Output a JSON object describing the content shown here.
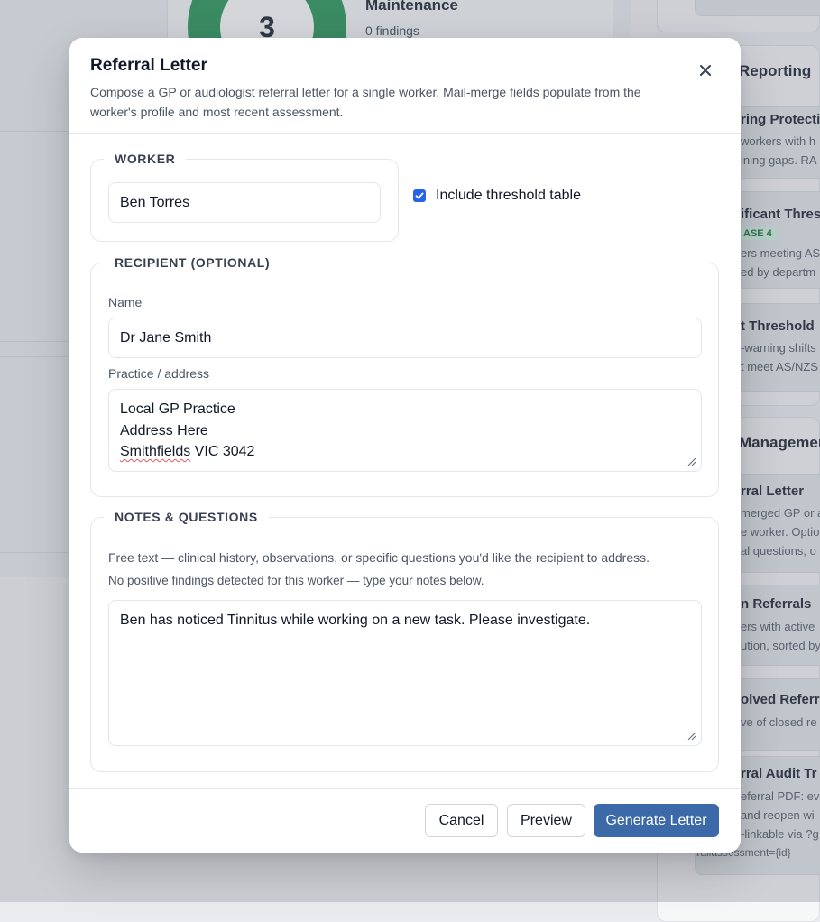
{
  "background": {
    "dashboard": {
      "donut_value": "3",
      "maintenance_title": "Maintenance",
      "maintenance_sub": "0 findings"
    },
    "reporting": {
      "heading": "Reporting",
      "tiles": [
        {
          "title": "ring Protecti",
          "lines": [
            "workers with h",
            "ining gaps. RA"
          ]
        },
        {
          "title": "ificant Thres",
          "badge": "ASE 4",
          "lines": [
            "ers meeting AS",
            "ed by departm"
          ]
        },
        {
          "title": "t Threshold",
          "lines": [
            "-warning shifts",
            "t meet AS/NZS"
          ]
        }
      ]
    },
    "management": {
      "heading": "Managemen",
      "tiles": [
        {
          "title": "rral Letter",
          "lines": [
            "merged GP or a",
            "e worker. Optio",
            "al questions, o"
          ]
        },
        {
          "title": "n Referrals",
          "lines": [
            "ers with active",
            "ution, sorted by"
          ]
        },
        {
          "title": "olved Referra",
          "lines": [
            "ve of closed re"
          ]
        },
        {
          "title": "rral Audit Tr",
          "lines": [
            "eferral PDF: eve",
            "and reopen wi",
            "-linkable via ?g",
            "trailassessment={id}"
          ]
        }
      ]
    }
  },
  "modal": {
    "title": "Referral Letter",
    "subtitle": "Compose a GP or audiologist referral letter for a single worker. Mail-merge fields populate from the worker's profile and most recent assessment.",
    "close_label": "×",
    "worker": {
      "legend": "WORKER",
      "value": "Ben Torres"
    },
    "include_threshold": {
      "label": "Include threshold table",
      "checked": true
    },
    "recipient": {
      "legend": "RECIPIENT (OPTIONAL)",
      "name_label": "Name",
      "name_value": "Dr Jane Smith",
      "address_label": "Practice / address",
      "address_lines": [
        "Local GP Practice",
        "Address Here",
        "Smithfields VIC 3042"
      ]
    },
    "notes": {
      "legend": "NOTES & QUESTIONS",
      "help": "Free text — clinical history, observations, or specific questions you'd like the recipient to address.",
      "no_findings": "No positive findings detected for this worker — type your notes below.",
      "value": "Ben has noticed Tinnitus while working on a new task. Please investigate."
    },
    "buttons": {
      "cancel": "Cancel",
      "preview": "Preview",
      "generate": "Generate Letter"
    }
  },
  "colors": {
    "primary_button": "#3c6aa8",
    "checkbox": "#2563eb",
    "donut": "#1c8f4e"
  }
}
